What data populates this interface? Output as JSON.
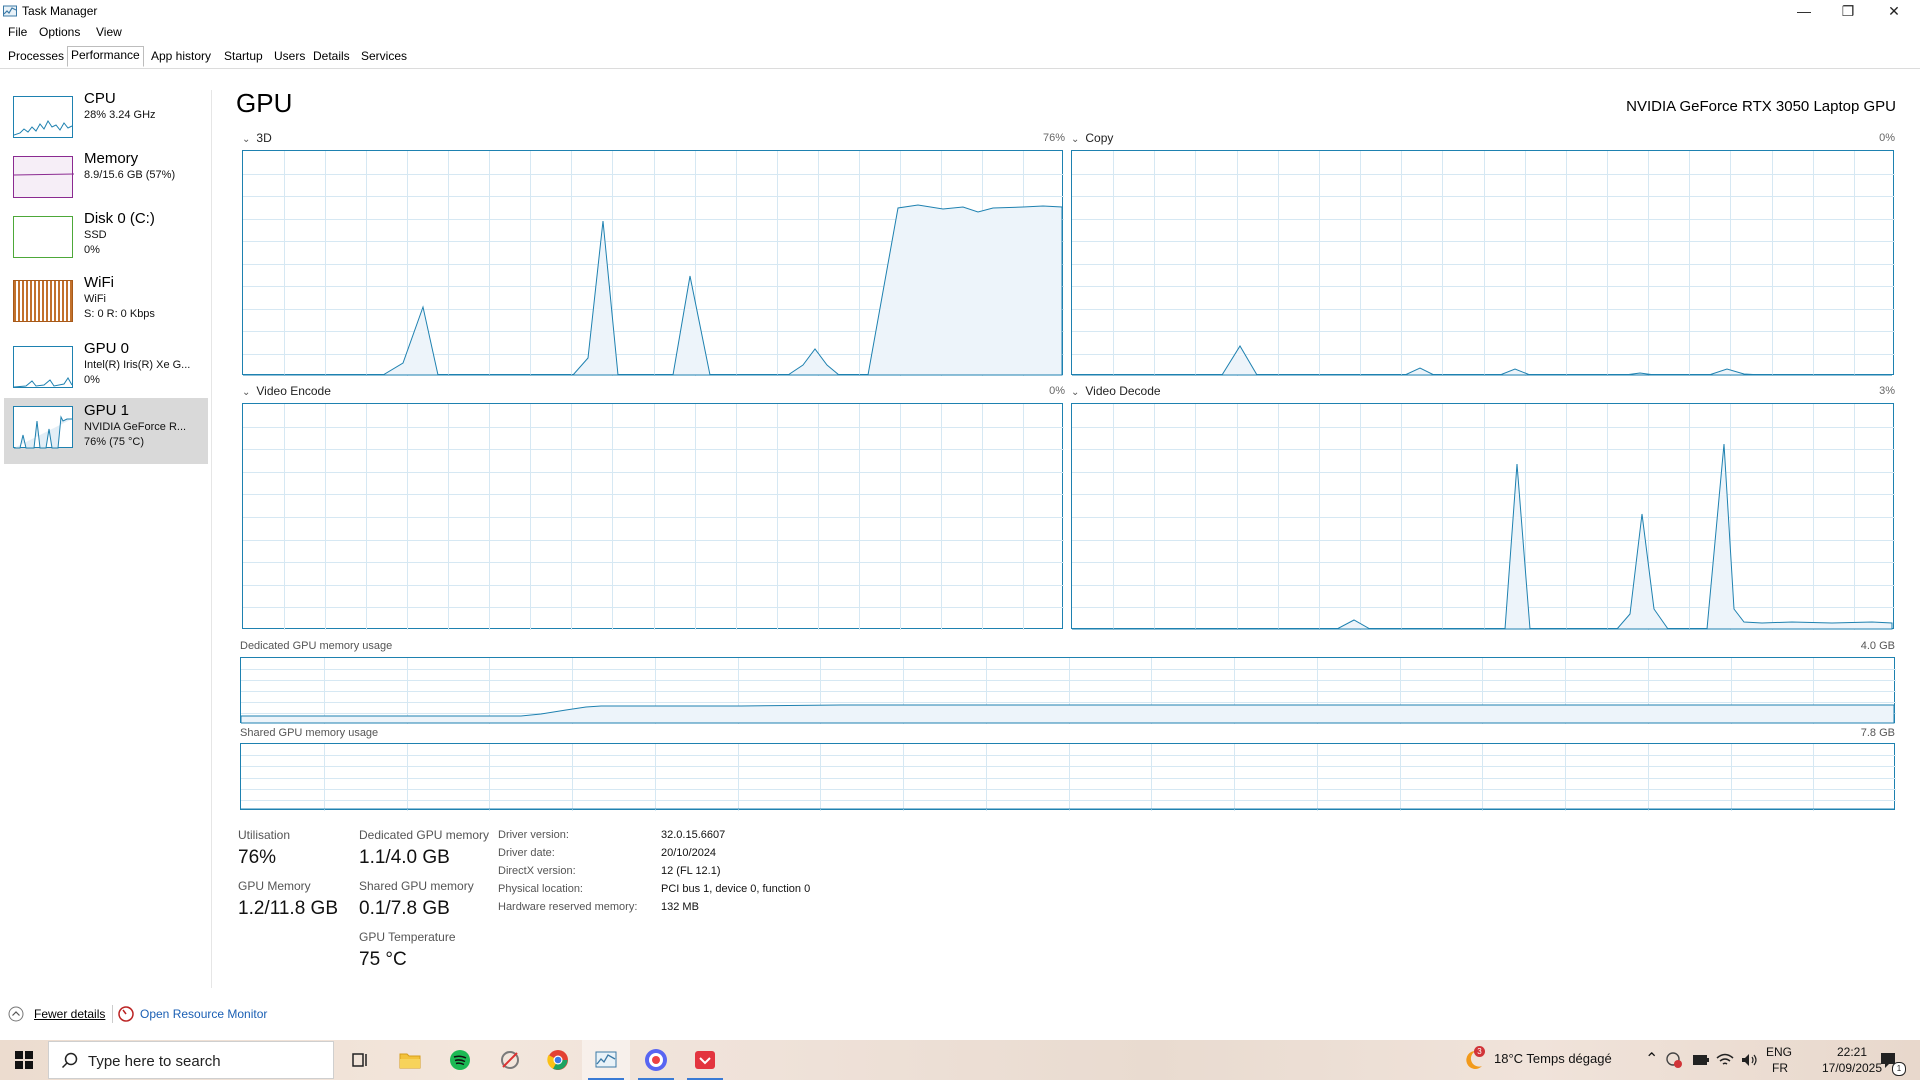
{
  "window": {
    "title": "Task Manager",
    "minimize_glyph": "—",
    "maximize_glyph": "❐",
    "close_glyph": "✕"
  },
  "menu": [
    "File",
    "Options",
    "View"
  ],
  "tabs": [
    "Processes",
    "Performance",
    "App history",
    "Startup",
    "Users",
    "Details",
    "Services"
  ],
  "active_tab": "Performance",
  "sidebar": {
    "items": [
      {
        "name": "CPU",
        "sub1": "28% 3.24 GHz",
        "sub2": "",
        "color": "#1e81b0"
      },
      {
        "name": "Memory",
        "sub1": "8.9/15.6 GB (57%)",
        "sub2": "",
        "color": "#8b2a91"
      },
      {
        "name": "Disk 0 (C:)",
        "sub1": "SSD",
        "sub2": "0%",
        "color": "#4da839"
      },
      {
        "name": "WiFi",
        "sub1": "WiFi",
        "sub2": "S: 0 R: 0 Kbps",
        "color": "#a75a1a"
      },
      {
        "name": "GPU 0",
        "sub1": "Intel(R) Iris(R) Xe G...",
        "sub2": "0%",
        "color": "#1e81b0"
      },
      {
        "name": "GPU 1",
        "sub1": "NVIDIA GeForce R...",
        "sub2": "76% (75 °C)",
        "color": "#1e81b0"
      }
    ],
    "selected_index": 5
  },
  "main": {
    "title": "GPU",
    "model": "NVIDIA GeForce RTX 3050 Laptop GPU",
    "engines": [
      {
        "label": "3D",
        "value": "76%"
      },
      {
        "label": "Copy",
        "value": "0%"
      },
      {
        "label": "Video Encode",
        "value": "0%"
      },
      {
        "label": "Video Decode",
        "value": "3%"
      }
    ],
    "dedicated_memory_graph": {
      "label": "Dedicated GPU memory usage",
      "max": "4.0 GB"
    },
    "shared_memory_graph": {
      "label": "Shared GPU memory usage",
      "max": "7.8 GB"
    },
    "stats": {
      "utilisation": {
        "label": "Utilisation",
        "value": "76%"
      },
      "dedicated": {
        "label": "Dedicated GPU memory",
        "value": "1.1/4.0 GB"
      },
      "gpu_memory": {
        "label": "GPU Memory",
        "value": "1.2/11.8 GB"
      },
      "shared": {
        "label": "Shared GPU memory",
        "value": "0.1/7.8 GB"
      },
      "temperature": {
        "label": "GPU Temperature",
        "value": "75 °C"
      }
    },
    "details": [
      {
        "key": "Driver version:",
        "value": "32.0.15.6607"
      },
      {
        "key": "Driver date:",
        "value": "20/10/2024"
      },
      {
        "key": "DirectX version:",
        "value": "12 (FL 12.1)"
      },
      {
        "key": "Physical location:",
        "value": "PCI bus 1, device 0, function 0"
      },
      {
        "key": "Hardware reserved memory:",
        "value": "132 MB"
      }
    ]
  },
  "footer": {
    "fewer_details": "Fewer details",
    "open_resource_monitor": "Open Resource Monitor"
  },
  "taskbar": {
    "search_placeholder": "Type here to search",
    "weather_badge": "3",
    "weather": "18°C  Temps dégagé",
    "lang_top": "ENG",
    "lang_bottom": "FR",
    "time": "22:21",
    "date": "17/09/2025",
    "notifications": "1"
  },
  "colors": {
    "accent": "#1e81b0",
    "grid": "#d6e8f3",
    "fill": "#f1f6fa"
  }
}
